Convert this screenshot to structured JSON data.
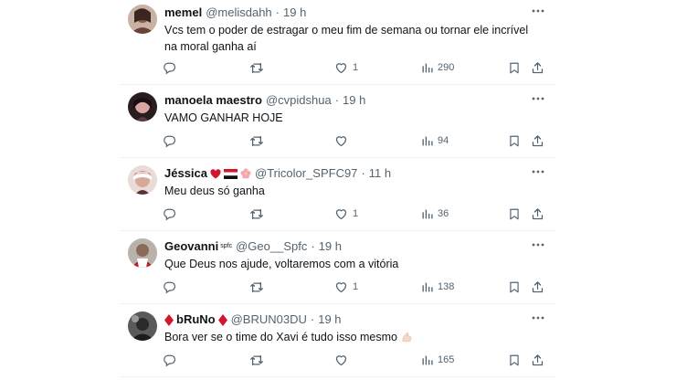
{
  "tweets": [
    {
      "display_name": "memel",
      "handle": "@melisdahh",
      "separator": "·",
      "time": "19 h",
      "text": "Vcs tem o poder de estragar o meu fim de semana ou tornar ele incrível na moral ganha aí",
      "likes": "1",
      "views": "290",
      "avatar_color": "#b08a77"
    },
    {
      "display_name": "manoela maestro",
      "handle": "@cvpidshua",
      "separator": "·",
      "time": "19 h",
      "text": "VAMO GANHAR HOJE",
      "likes": "",
      "views": "94",
      "avatar_color": "#3a2a2e"
    },
    {
      "display_name": "Jéssica",
      "handle": "@Tricolor_SPFC97",
      "separator": "·",
      "time": "11 h",
      "text": "Meu deus só ganha",
      "likes": "1",
      "views": "36",
      "avatar_color": "#c9a9a0",
      "decorations": [
        "heart-emoji",
        "tricolor-flag-emoji",
        "blossom-emoji"
      ]
    },
    {
      "display_name": "Geovanni",
      "name_suffix": "spfc",
      "handle": "@Geo__Spfc",
      "separator": "·",
      "time": "19 h",
      "text": "Que Deus nos ajude, voltaremos com a vitória",
      "likes": "1",
      "views": "138",
      "avatar_color": "#7a7068"
    },
    {
      "display_name": "bRuNo",
      "handle": "@BRUN03DU",
      "separator": "·",
      "time": "19 h",
      "text": "Bora ver se o time do Xavi é tudo isso mesmo",
      "likes": "",
      "views": "165",
      "avatar_color": "#2f2f2f",
      "decorations": [
        "red-diamond-emoji",
        "red-diamond-emoji",
        "flexed-biceps-emoji"
      ]
    }
  ],
  "colors": {
    "text_primary": "#0f1419",
    "text_secondary": "#536471",
    "divider": "#eff3f4",
    "emoji_red": "#d1172e"
  }
}
